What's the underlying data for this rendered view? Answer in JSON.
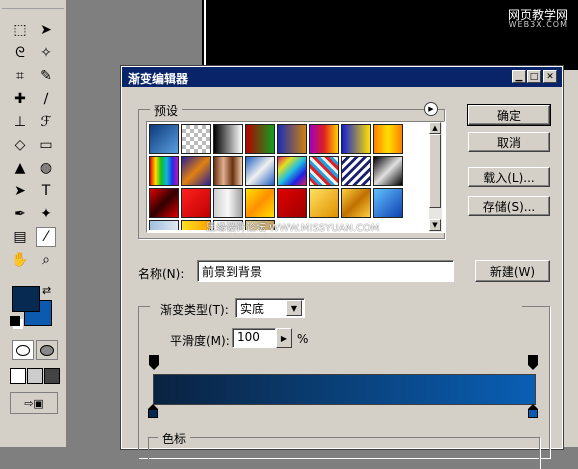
{
  "watermark": {
    "site_cn": "网页教学网",
    "site_url": "WEB3X.COM"
  },
  "dialog": {
    "title": "渐变编辑器",
    "presets_label": "预设",
    "ok_label": "确定",
    "cancel_label": "取消",
    "load_label": "载入(L)...",
    "save_label": "存储(S)...",
    "name_label": "名称(N):",
    "name_value": "前景到背景",
    "new_label": "新建(W)",
    "gradient_type_label": "渐变类型(T):",
    "gradient_type_value": "实底",
    "smoothness_label": "平滑度(M):",
    "smoothness_value": "100",
    "percent_sign": "%",
    "stops_label": "色标",
    "overlay_watermark": "思缘设计论坛  WWW.MISSYUAN.COM"
  },
  "colors": {
    "gradient_start": "#0a2240",
    "gradient_end": "#0a5fb4",
    "foreground": "#072a52",
    "background": "#0c5ab0",
    "titlebar": "#0a246a"
  },
  "swatches": [
    "linear-gradient(135deg,#0c3a7a,#5a9ee0)",
    "repeating-conic-gradient(#bbb 0 25%,#fff 0 50%) 0 0/8px 8px",
    "linear-gradient(90deg,#000,#fff)",
    "linear-gradient(90deg,#b40000,#10a020)",
    "linear-gradient(90deg,#1a2fb0,#d08010)",
    "linear-gradient(90deg,#a000c0,#e02020,#ffd000)",
    "linear-gradient(90deg,#1020d0,#ffe000)",
    "linear-gradient(90deg,#ff8000,#ffe000,#ff8000)",
    "linear-gradient(90deg,#e00000,#ffe000,#10c020,#10b0e0,#2030e0,#c010c0)",
    "linear-gradient(135deg,#2a2090,#e08010,#2a2090)",
    "linear-gradient(90deg,#6a3010,#e0b090,#6a3010,#f0d0b0)",
    "linear-gradient(135deg,#2060c0,#f0f0f0,#2060c0)",
    "linear-gradient(135deg,#e02060,#e0e020,#20c0e0,#2020e0,#e02060)",
    "repeating-linear-gradient(45deg,#f0f0f0 0 3px,#e02020 3px 6px,#20a0e0 6px 9px)",
    "repeating-linear-gradient(135deg,#fff 0 3px,#1a2070 3px 6px)",
    "linear-gradient(135deg,#000,#e0e0e0,#000)",
    "linear-gradient(135deg,#e00000,#300000,#e00000)",
    "linear-gradient(135deg,#ff2020,#c00000)",
    "linear-gradient(90deg,#d0d0d0,#f8f8f8,#a0a0a0)",
    "linear-gradient(135deg,#ffe000,#ff9000,#ffe000)",
    "linear-gradient(135deg,#e00000,#a00000)",
    "linear-gradient(135deg,#ffe060,#e09000)",
    "linear-gradient(135deg,#ffd040,#c07000,#ffd040)",
    "linear-gradient(135deg,#60c0ff,#1040b0)",
    "linear-gradient(90deg,#a0c0e0,#e0e8f0)",
    "linear-gradient(90deg,#ffe020,#ffa000)",
    "linear-gradient(90deg,#ffffff,#d0d0d0)",
    "linear-gradient(90deg,#e0d0a0,#c0a060)"
  ],
  "tools": [
    "marquee-icon",
    "move-icon",
    "lasso-icon",
    "magic-wand-icon",
    "crop-icon",
    "slice-icon",
    "healing-brush-icon",
    "brush-icon",
    "stamp-icon",
    "history-brush-icon",
    "eraser-icon",
    "gradient-icon",
    "blur-icon",
    "dodge-icon",
    "path-select-icon",
    "type-icon",
    "pen-icon",
    "shape-icon",
    "notes-icon",
    "eyedropper-icon",
    "hand-icon",
    "zoom-icon"
  ]
}
